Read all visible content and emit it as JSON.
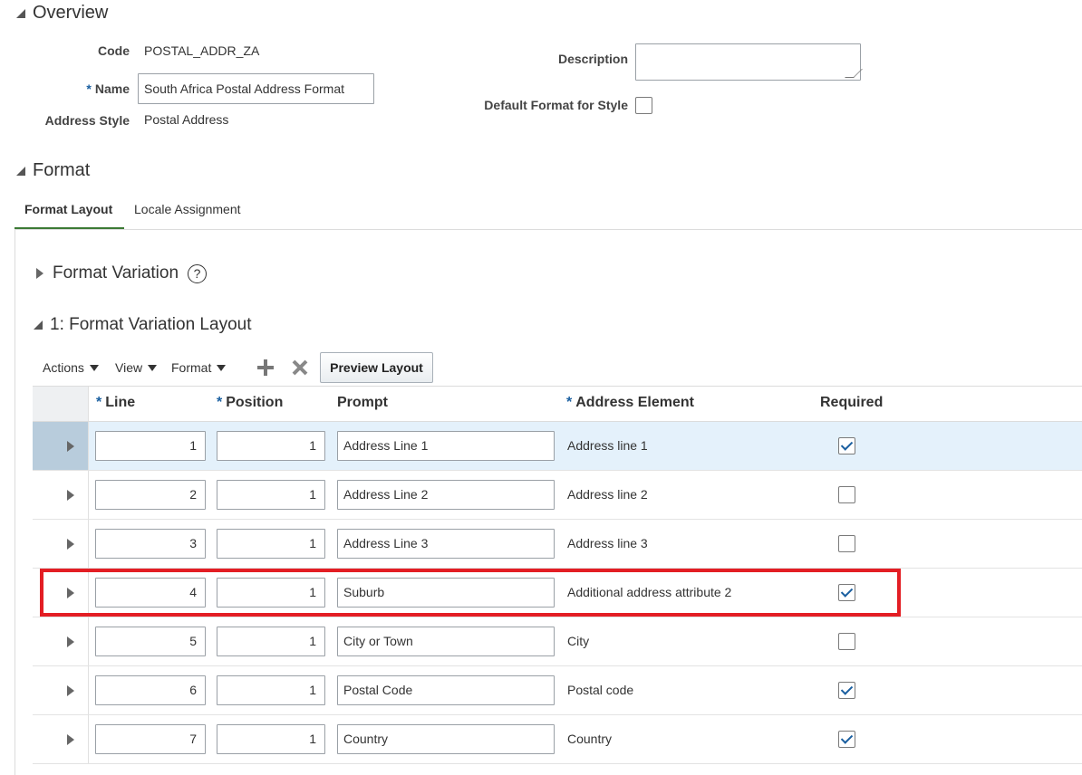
{
  "overview": {
    "title": "Overview",
    "code_label": "Code",
    "code_value": "POSTAL_ADDR_ZA",
    "name_label": "Name",
    "name_value": "South Africa Postal Address Format",
    "style_label": "Address Style",
    "style_value": "Postal Address",
    "description_label": "Description",
    "description_value": "",
    "default_label": "Default Format for Style",
    "default_checked": false
  },
  "format": {
    "title": "Format",
    "tabs": [
      {
        "label": "Format Layout",
        "active": true
      },
      {
        "label": "Locale Assignment",
        "active": false
      }
    ]
  },
  "variation": {
    "title": "Format Variation",
    "help_glyph": "?"
  },
  "layout": {
    "title": "1: Format Variation Layout",
    "toolbar": {
      "actions": "Actions",
      "view": "View",
      "format": "Format",
      "add_icon": "plus-icon",
      "delete_icon": "x-icon",
      "preview": "Preview Layout"
    },
    "required_marker": "*",
    "columns": {
      "line": "Line",
      "position": "Position",
      "prompt": "Prompt",
      "element": "Address Element",
      "required": "Required"
    },
    "rows": [
      {
        "line": "1",
        "position": "1",
        "prompt": "Address Line 1",
        "element": "Address line 1",
        "required": true
      },
      {
        "line": "2",
        "position": "1",
        "prompt": "Address Line 2",
        "element": "Address line 2",
        "required": false
      },
      {
        "line": "3",
        "position": "1",
        "prompt": "Address Line 3",
        "element": "Address line 3",
        "required": false
      },
      {
        "line": "4",
        "position": "1",
        "prompt": "Suburb",
        "element": "Additional address attribute 2",
        "required": true
      },
      {
        "line": "5",
        "position": "1",
        "prompt": "City or Town",
        "element": "City",
        "required": false
      },
      {
        "line": "6",
        "position": "1",
        "prompt": "Postal Code",
        "element": "Postal code",
        "required": true
      },
      {
        "line": "7",
        "position": "1",
        "prompt": "Country",
        "element": "Country",
        "required": true
      }
    ]
  },
  "colors": {
    "accent": "#1a5fa0",
    "highlight": "#e31e24",
    "selected_row": "#e4f1fb",
    "tab_underline": "#3c7a35"
  }
}
